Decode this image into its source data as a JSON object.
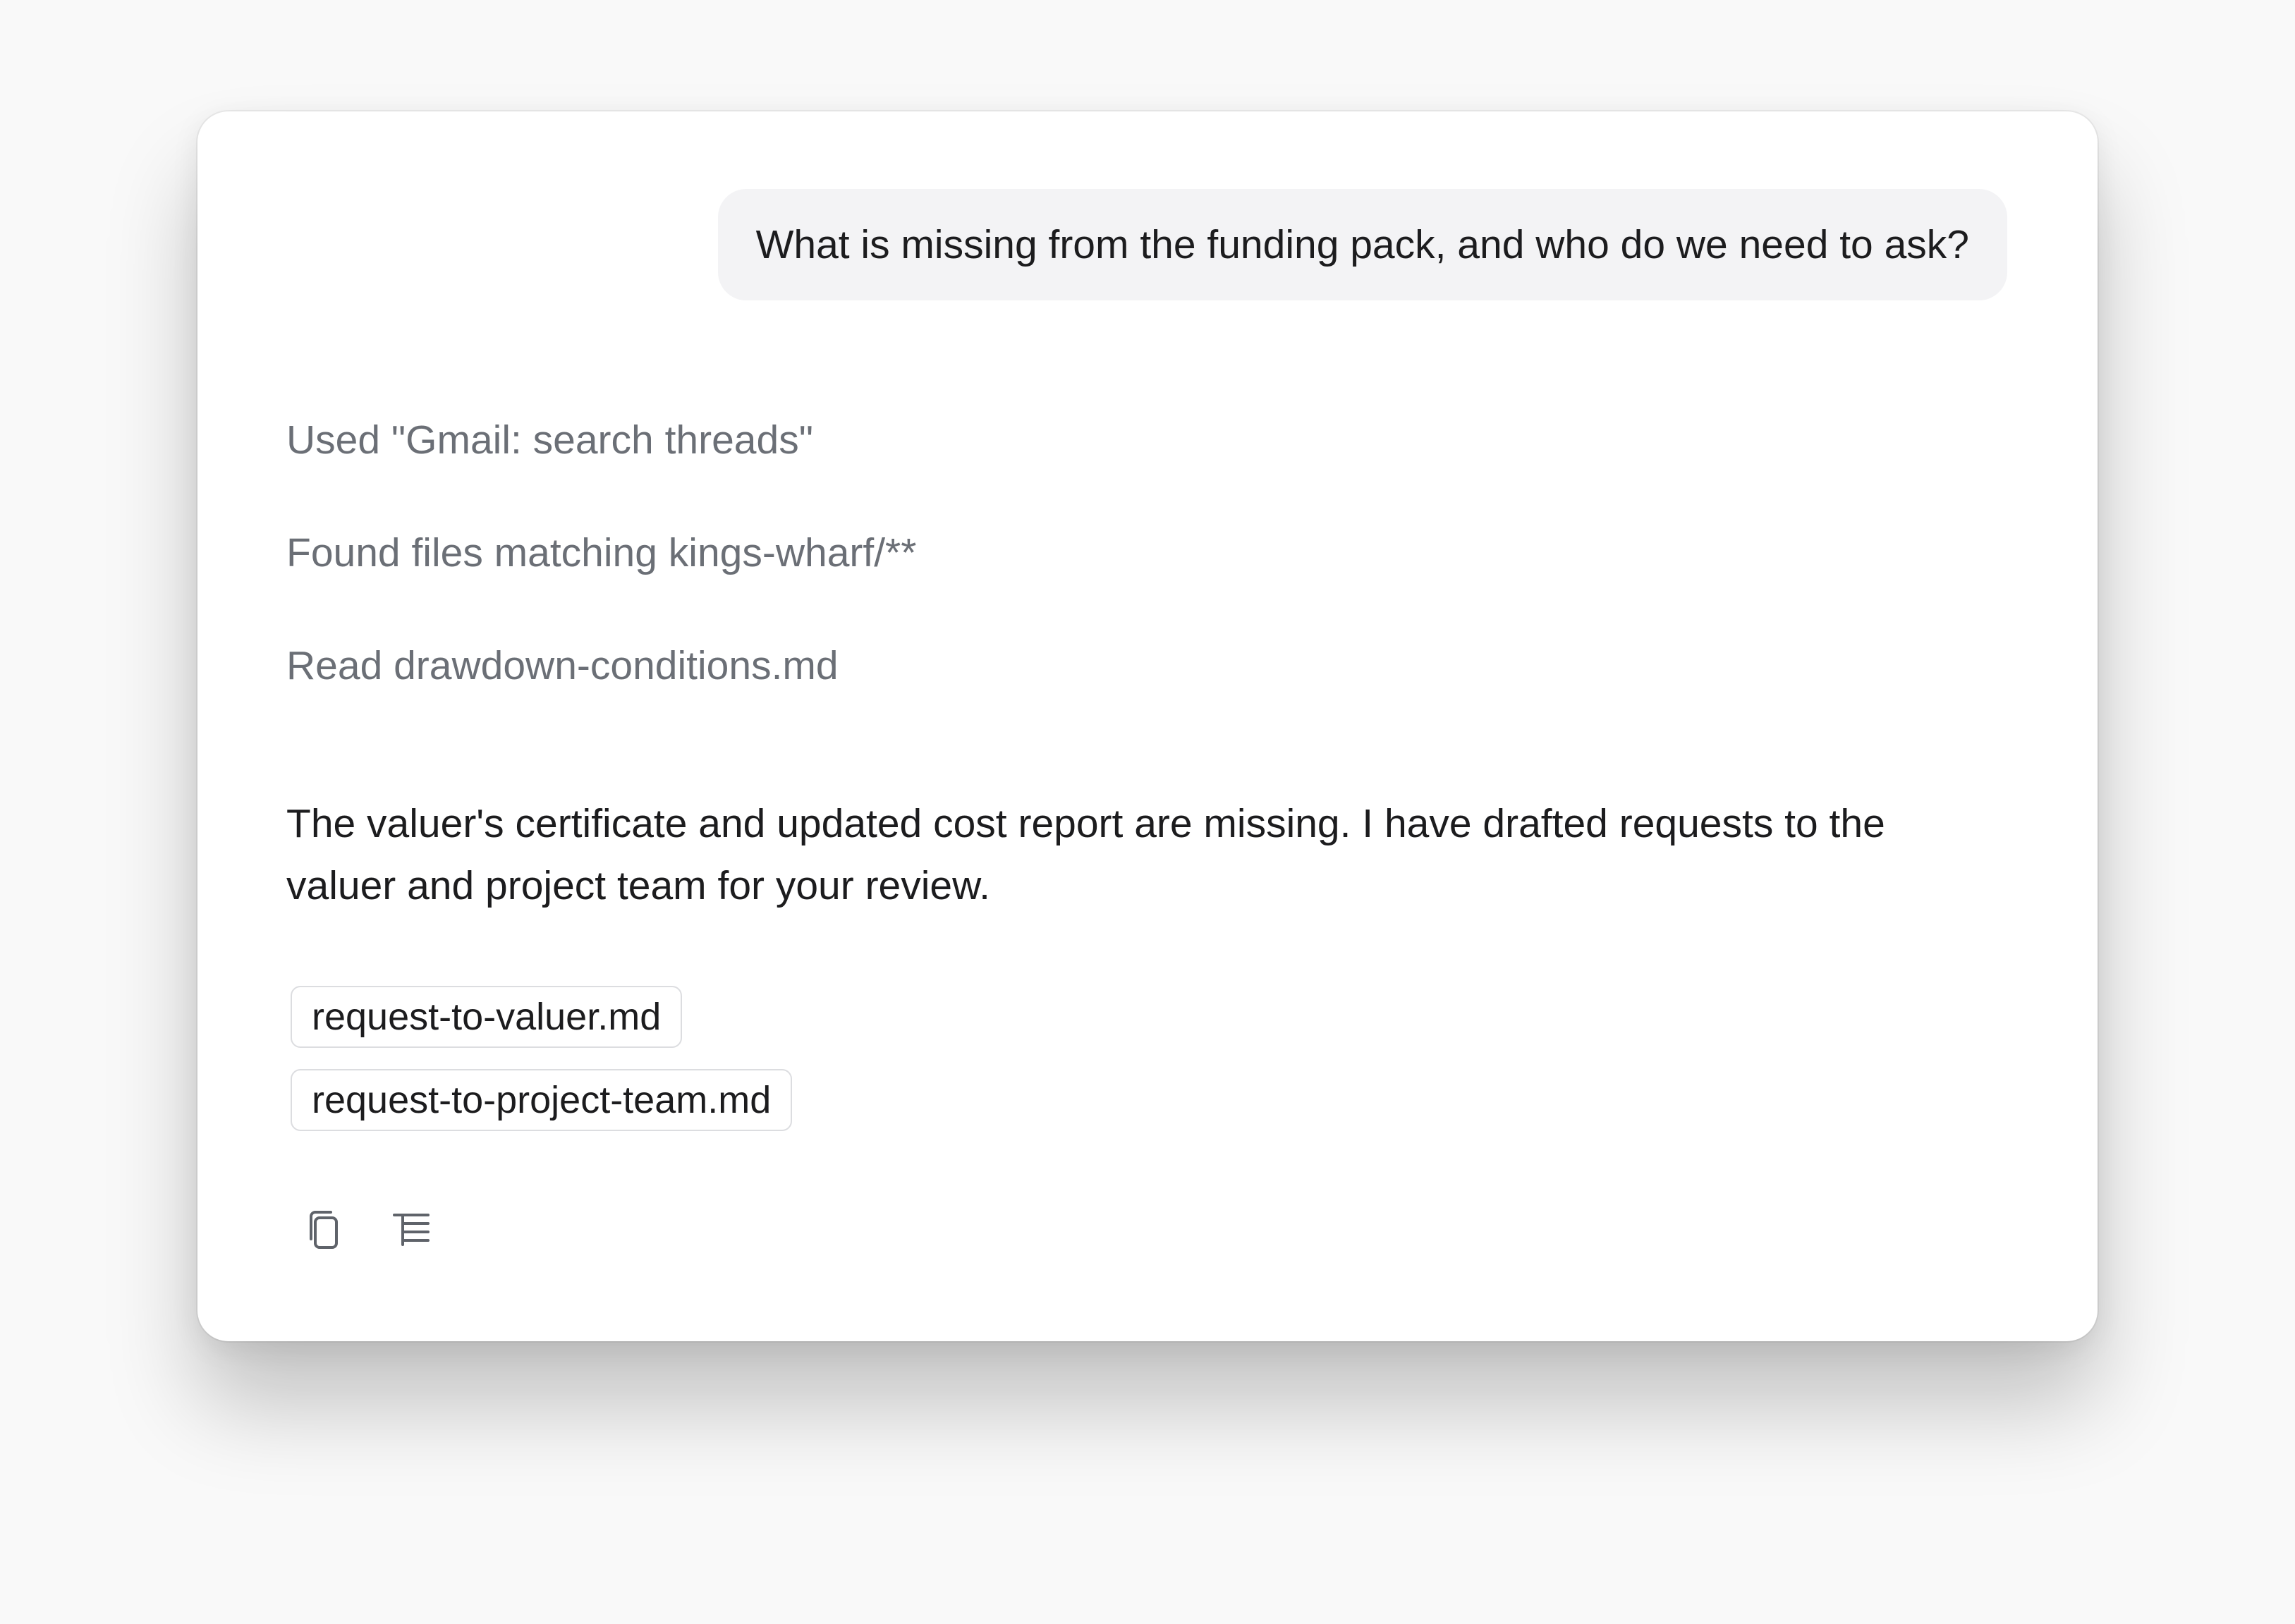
{
  "conversation": {
    "user_message": "What is missing from the funding pack, and who do we need to ask?",
    "tool_steps": [
      {
        "label": "Used \"Gmail: search threads\""
      },
      {
        "label": "Found files matching kings-wharf/**"
      },
      {
        "label": "Read drawdown-conditions.md"
      }
    ],
    "assistant_message": "The valuer's certificate and updated cost report are missing. I have drafted requests to the valuer and project team for your review.",
    "attachments": [
      {
        "filename": "request-to-valuer.md"
      },
      {
        "filename": "request-to-project-team.md"
      }
    ],
    "actions": [
      {
        "icon": "copy-icon"
      },
      {
        "icon": "outline-icon"
      }
    ]
  }
}
